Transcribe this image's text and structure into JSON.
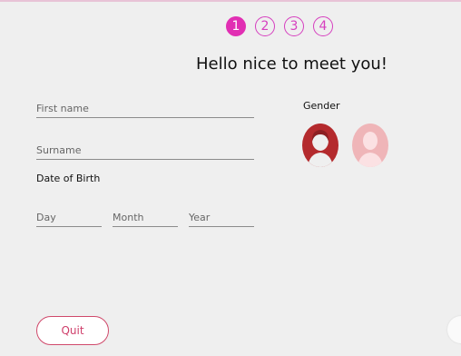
{
  "stepper": {
    "steps": [
      "1",
      "2",
      "3",
      "4"
    ],
    "active_step": "1"
  },
  "greeting": "Hello nice to meet you!",
  "form": {
    "first_name_placeholder": "First name",
    "surname_placeholder": "Surname",
    "dob_label": "Date of Birth",
    "day_placeholder": "Day",
    "month_placeholder": "Month",
    "year_placeholder": "Year",
    "gender_label": "Gender"
  },
  "buttons": {
    "quit_label": "Quit"
  },
  "icons": {
    "female": "female-avatar-icon",
    "male": "male-avatar-icon"
  },
  "colors": {
    "accent": "#e12fb3",
    "quit": "#cf3f6b",
    "female_avatar": "#b42a2d",
    "male_avatar": "#efb5b8"
  }
}
